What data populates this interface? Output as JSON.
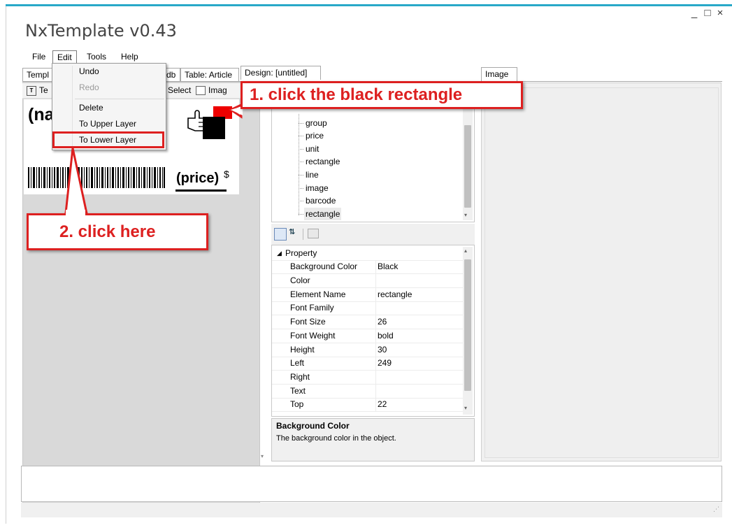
{
  "window": {
    "title": "NxTemplate v0.43",
    "minimize_glyph": "_",
    "maximize_glyph": "□",
    "close_glyph": "×"
  },
  "menu": {
    "file": "File",
    "edit": "Edit",
    "tools": "Tools",
    "help": "Help"
  },
  "edit_menu": {
    "undo": "Undo",
    "redo": "Redo",
    "delete": "Delete",
    "to_upper_layer": "To Upper Layer",
    "to_lower_layer": "To Lower Layer"
  },
  "tabs": {
    "template": "Templ",
    "db": "db",
    "table": "Table: Article",
    "design": "Design: [untitled]",
    "image": "Image"
  },
  "design_toolbar": {
    "text_tool": "Te",
    "select_tool": "Select",
    "image_tool": "Imag"
  },
  "label_canvas": {
    "name_field": "(na",
    "price_field": "(price)",
    "currency": "$"
  },
  "element_tree": {
    "items": [
      "group",
      "price",
      "unit",
      "rectangle",
      "line",
      "image",
      "barcode",
      "rectangle"
    ],
    "selected_index": 7
  },
  "property_grid": {
    "category": "Property",
    "rows": [
      {
        "name": "Background Color",
        "value": "Black"
      },
      {
        "name": "Color",
        "value": ""
      },
      {
        "name": "Element Name",
        "value": "rectangle"
      },
      {
        "name": "Font Family",
        "value": ""
      },
      {
        "name": "Font Size",
        "value": "26"
      },
      {
        "name": "Font Weight",
        "value": "bold"
      },
      {
        "name": "Height",
        "value": "30"
      },
      {
        "name": "Left",
        "value": "249"
      },
      {
        "name": "Right",
        "value": ""
      },
      {
        "name": "Text",
        "value": ""
      },
      {
        "name": "Top",
        "value": "22"
      }
    ],
    "description_title": "Background Color",
    "description_text": "The background color in the object."
  },
  "callouts": {
    "step1": "1. click the black rectangle",
    "step2": "2. click here"
  },
  "colors": {
    "callout_red": "#dd2020",
    "accent_line": "#28a8c8",
    "rectangle_black": "#000000"
  }
}
